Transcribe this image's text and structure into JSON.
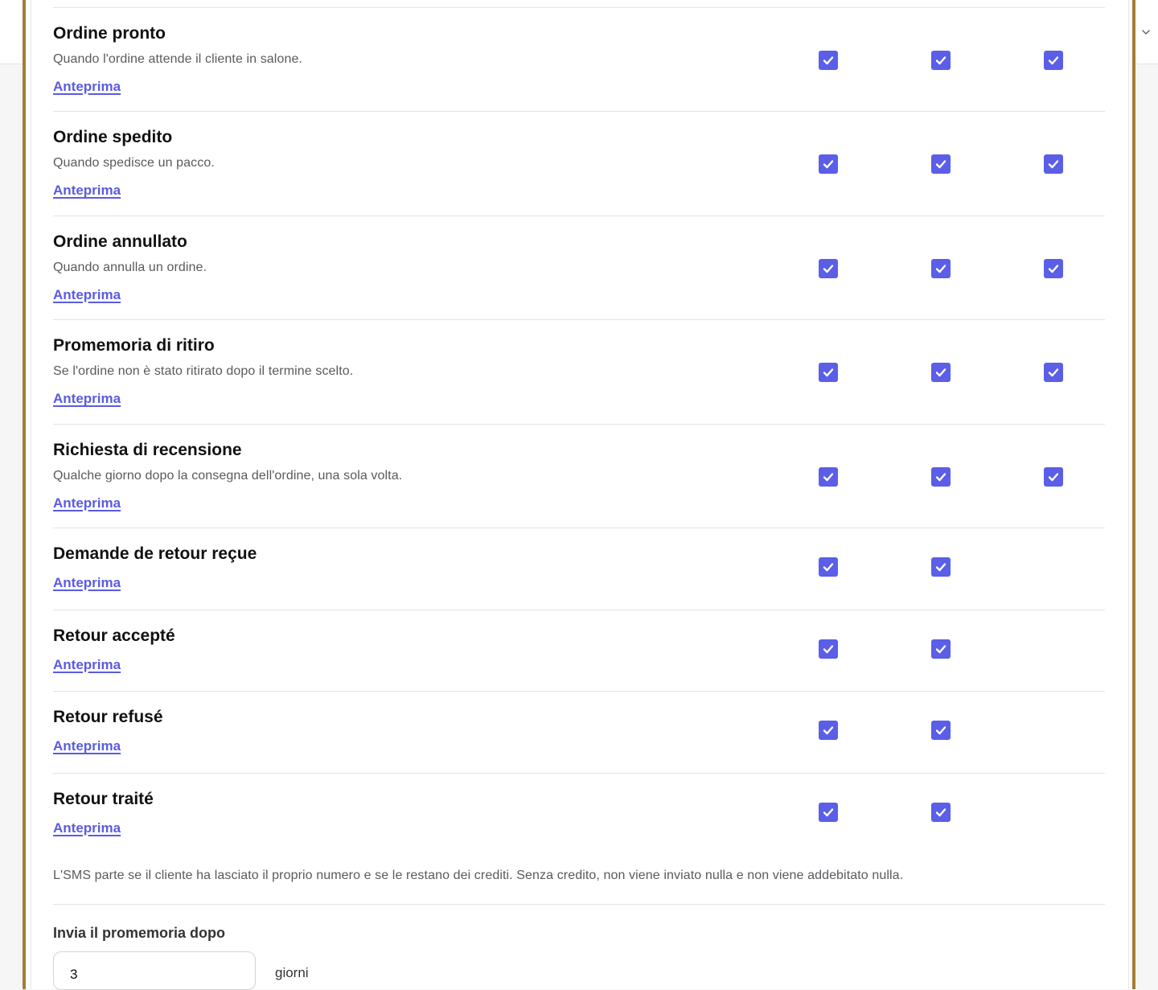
{
  "notifications": [
    {
      "title": "Ordine pronto",
      "description": "Quando l'ordine attende il cliente in salone.",
      "link": "Anteprima",
      "channels": [
        true,
        true,
        true
      ]
    },
    {
      "title": "Ordine spedito",
      "description": "Quando spedisce un pacco.",
      "link": "Anteprima",
      "channels": [
        true,
        true,
        true
      ]
    },
    {
      "title": "Ordine annullato",
      "description": "Quando annulla un ordine.",
      "link": "Anteprima",
      "channels": [
        true,
        true,
        true
      ]
    },
    {
      "title": "Promemoria di ritiro",
      "description": "Se l'ordine non è stato ritirato dopo il termine scelto.",
      "link": "Anteprima",
      "channels": [
        true,
        true,
        true
      ]
    },
    {
      "title": "Richiesta di recensione",
      "description": "Qualche giorno dopo la consegna dell'ordine, una sola volta.",
      "link": "Anteprima",
      "channels": [
        true,
        true,
        true
      ]
    },
    {
      "title": "Demande de retour reçue",
      "description": "",
      "link": "Anteprima",
      "channels": [
        true,
        true,
        null
      ]
    },
    {
      "title": "Retour accepté",
      "description": "",
      "link": "Anteprima",
      "channels": [
        true,
        true,
        null
      ]
    },
    {
      "title": "Retour refusé",
      "description": "",
      "link": "Anteprima",
      "channels": [
        true,
        true,
        null
      ]
    },
    {
      "title": "Retour traité",
      "description": "",
      "link": "Anteprima",
      "channels": [
        true,
        true,
        null
      ]
    }
  ],
  "sms_note": "L'SMS parte se il cliente ha lasciato il proprio numero e se le restano dei crediti. Senza credito, non viene inviato nulla e non viene addebitato nulla.",
  "reminder": {
    "label": "Invia il promemoria dopo",
    "value": "3",
    "unit": "giorni"
  },
  "colors": {
    "accent": "#5b5ee6",
    "link": "#5b5be0",
    "frame": "#a47d35"
  },
  "icons": {
    "topbar": "chevron-down-icon",
    "checkbox": "check-icon"
  }
}
